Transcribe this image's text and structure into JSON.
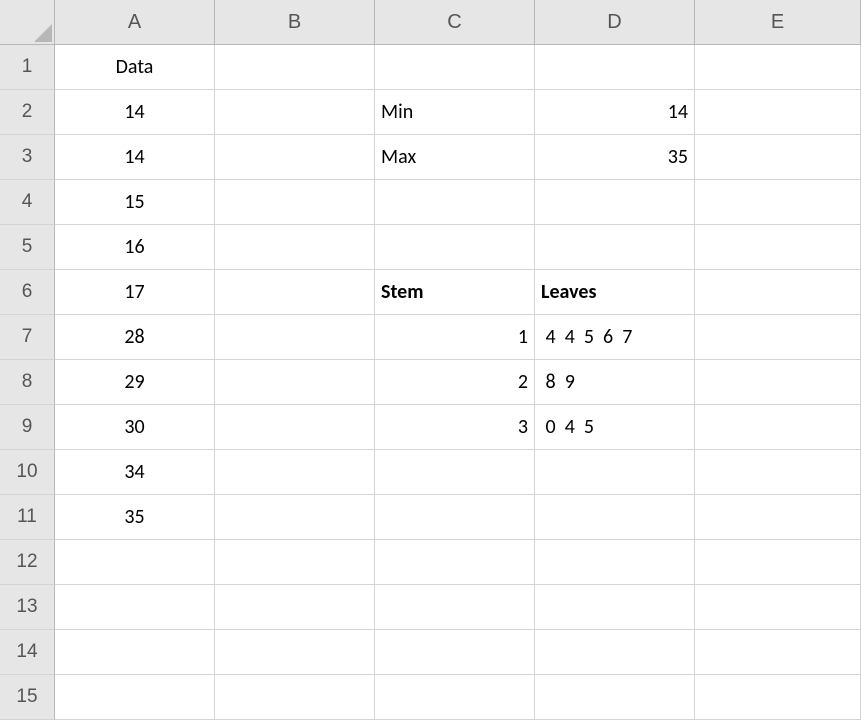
{
  "columns": [
    "A",
    "B",
    "C",
    "D",
    "E"
  ],
  "rows": [
    "1",
    "2",
    "3",
    "4",
    "5",
    "6",
    "7",
    "8",
    "9",
    "10",
    "11",
    "12",
    "13",
    "14",
    "15"
  ],
  "cells": {
    "A1": {
      "v": "Data",
      "align": "center"
    },
    "A2": {
      "v": "14",
      "align": "center"
    },
    "A3": {
      "v": "14",
      "align": "center"
    },
    "A4": {
      "v": "15",
      "align": "center"
    },
    "A5": {
      "v": "16",
      "align": "center"
    },
    "A6": {
      "v": "17",
      "align": "center"
    },
    "A7": {
      "v": "28",
      "align": "center"
    },
    "A8": {
      "v": "29",
      "align": "center"
    },
    "A9": {
      "v": "30",
      "align": "center"
    },
    "A10": {
      "v": "34",
      "align": "center"
    },
    "A11": {
      "v": "35",
      "align": "center"
    },
    "C2": {
      "v": "Min",
      "align": "left"
    },
    "C3": {
      "v": "Max",
      "align": "left"
    },
    "D2": {
      "v": "14",
      "align": "right"
    },
    "D3": {
      "v": "35",
      "align": "right"
    },
    "C6": {
      "v": "Stem",
      "align": "left",
      "bold": true
    },
    "D6": {
      "v": "Leaves",
      "align": "left",
      "bold": true
    },
    "C7": {
      "v": "1",
      "align": "right"
    },
    "C8": {
      "v": "2",
      "align": "right"
    },
    "C9": {
      "v": "3",
      "align": "right"
    },
    "D7": {
      "v": " 4  4  5  6  7",
      "align": "left"
    },
    "D8": {
      "v": " 8  9",
      "align": "left"
    },
    "D9": {
      "v": " 0  4  5",
      "align": "left"
    }
  }
}
